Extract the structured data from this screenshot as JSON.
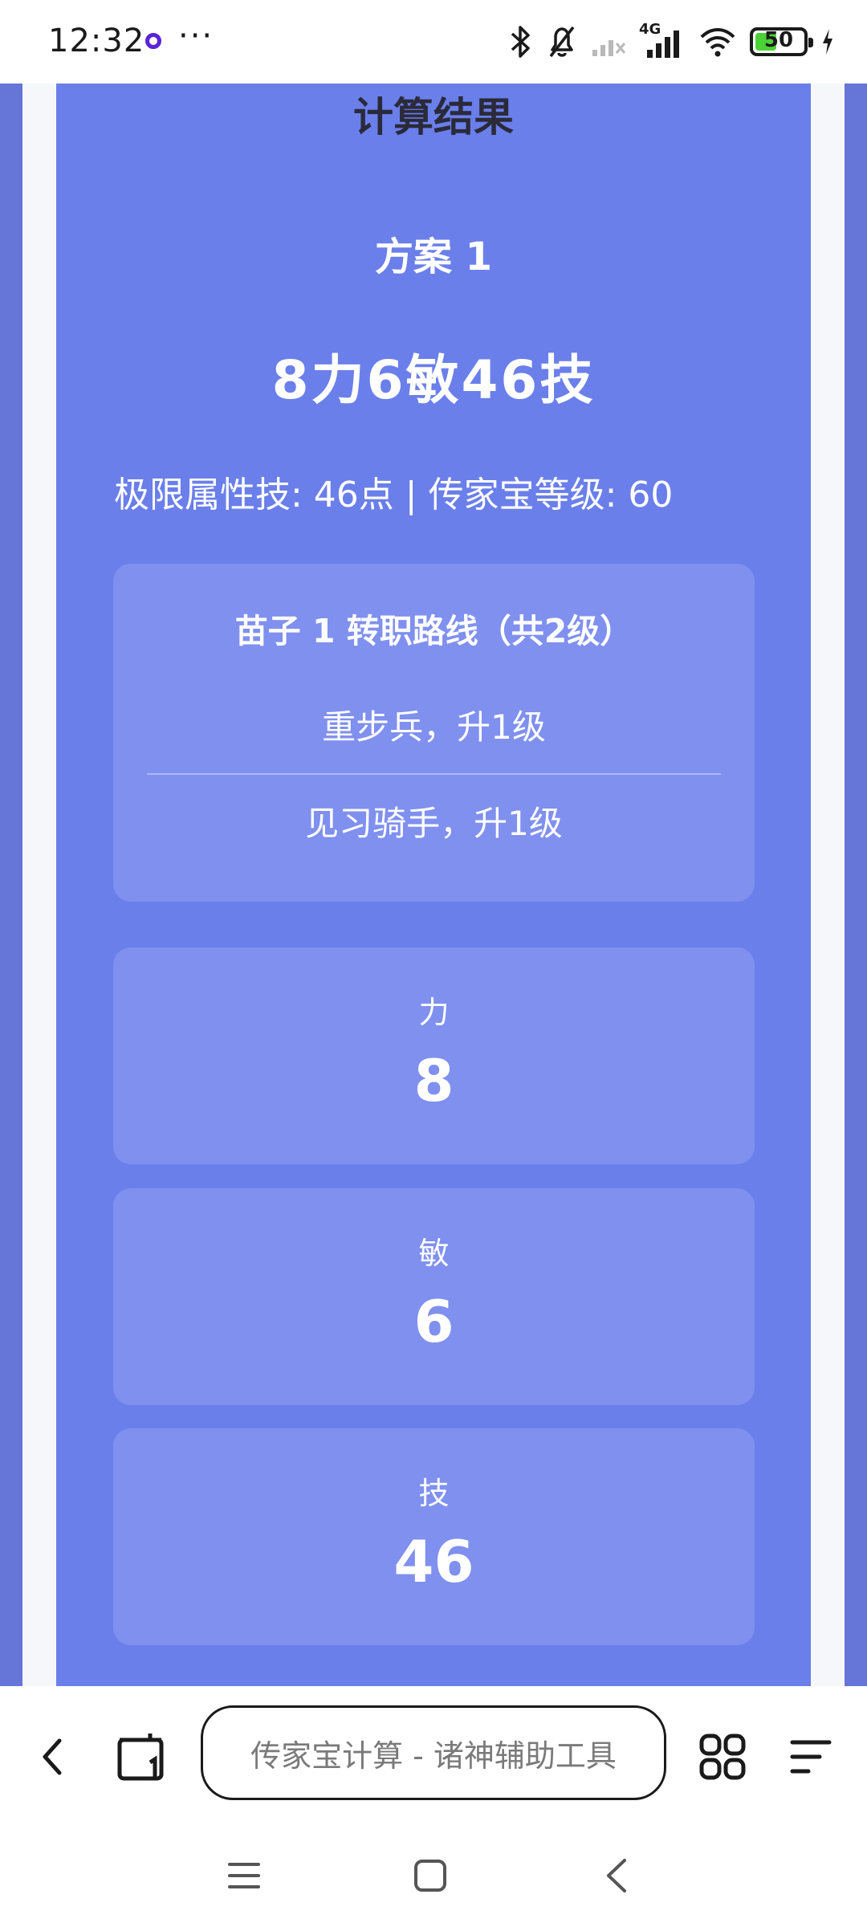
{
  "status_bar": {
    "time": "12:32",
    "more": "···",
    "network": "4G",
    "battery": "50",
    "battery_fraction": 0.5,
    "battery_color": "#4cd137"
  },
  "result": {
    "section_title": "计算结果",
    "plan_title": "方案 1",
    "plan_summary": "8力6敏46技",
    "limit_text": "极限属性技: 46点 | 传家宝等级: 60",
    "route": {
      "title": "苗子 1 转职路线（共2级）",
      "steps": [
        "重步兵，升1级",
        "见习骑手，升1级"
      ]
    },
    "stats": [
      {
        "label": "力",
        "value": "8"
      },
      {
        "label": "敏",
        "value": "6"
      },
      {
        "label": "技",
        "value": "46"
      }
    ]
  },
  "browser": {
    "url_title": "传家宝计算 - 诸神辅助工具",
    "icons": [
      "back-icon",
      "tabs-icon",
      "apps-grid-icon",
      "menu-icon"
    ]
  },
  "nav": {
    "icons": [
      "menu-icon",
      "home-icon",
      "back-icon"
    ]
  },
  "colors": {
    "panel": "#6a7fea",
    "card": "#7f90ef",
    "title_text": "#2a2a3a"
  }
}
